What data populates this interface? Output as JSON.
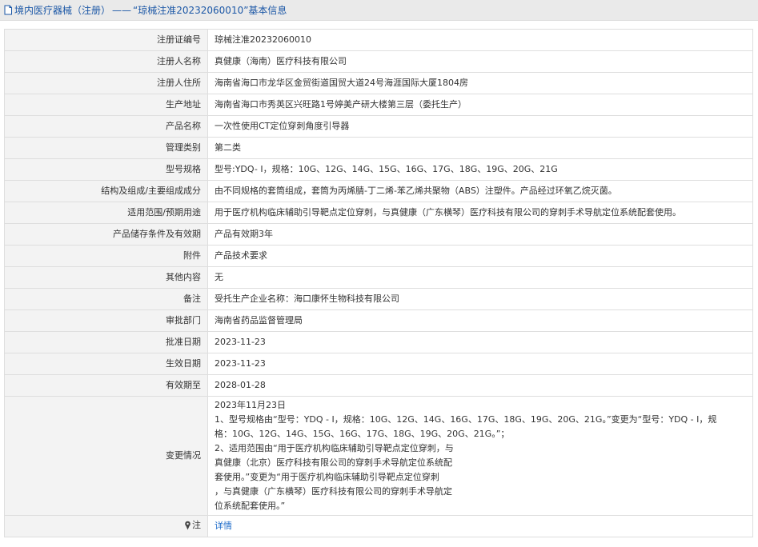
{
  "breadcrumb": {
    "section": "境内医疗器械（注册）",
    "separator": "——",
    "subject": "“琼械注准20232060010”基本信息"
  },
  "rows": [
    {
      "label": "注册证编号",
      "value": "琼械注准20232060010"
    },
    {
      "label": "注册人名称",
      "value": "真健康（海南）医疗科技有限公司"
    },
    {
      "label": "注册人住所",
      "value": "海南省海口市龙华区金贸街道国贸大道24号海涯国际大厦1804房"
    },
    {
      "label": "生产地址",
      "value": "海南省海口市秀英区兴旺路1号婷美产研大楼第三层（委托生产）"
    },
    {
      "label": "产品名称",
      "value": "一次性使用CT定位穿刺角度引导器"
    },
    {
      "label": "管理类别",
      "value": "第二类"
    },
    {
      "label": "型号规格",
      "value": "型号:YDQ- I，规格：10G、12G、14G、15G、16G、17G、18G、19G、20G、21G"
    },
    {
      "label": "结构及组成/主要组成成分",
      "value": "由不同规格的套筒组成，套筒为丙烯腈-丁二烯-苯乙烯共聚物（ABS）注塑件。产品经过环氧乙烷灭菌。"
    },
    {
      "label": "适用范围/预期用途",
      "value": "用于医疗机构临床辅助引导靶点定位穿刺，与真健康（广东横琴）医疗科技有限公司的穿刺手术导航定位系统配套使用。"
    },
    {
      "label": "产品储存条件及有效期",
      "value": "产品有效期3年"
    },
    {
      "label": "附件",
      "value": "产品技术要求"
    },
    {
      "label": "其他内容",
      "value": "无"
    },
    {
      "label": "备注",
      "value": "受托生产企业名称：海口康怀生物科技有限公司"
    },
    {
      "label": "审批部门",
      "value": "海南省药品监督管理局"
    },
    {
      "label": "批准日期",
      "value": "2023-11-23"
    },
    {
      "label": "生效日期",
      "value": "2023-11-23"
    },
    {
      "label": "有效期至",
      "value": "2028-01-28"
    }
  ],
  "changes": {
    "label": "变更情况",
    "lines": [
      "2023年11月23日",
      "1、型号规格由“型号：YDQ - I，规格：10G、12G、14G、16G、17G、18G、19G、20G、21G。”变更为“型号：YDQ - I，规",
      "格：10G、12G、14G、15G、16G、17G、18G、19G、20G、21G。”；",
      "2、适用范围由“用于医疗机构临床辅助引导靶点定位穿刺，与",
      "真健康（北京）医疗科技有限公司的穿刺手术导航定位系统配",
      "套使用。”变更为“用于医疗机构临床辅助引导靶点定位穿刺",
      "，与真健康（广东横琴）医疗科技有限公司的穿刺手术导航定",
      "位系统配套使用。”"
    ]
  },
  "note": {
    "label": "注",
    "link_text": "详情"
  },
  "colors": {
    "accent": "#1b57a6",
    "link": "#1b6ac9",
    "label_bg": "#f3f3f3",
    "border": "#dedede"
  },
  "icons": [
    "document-icon",
    "pin-icon"
  ]
}
